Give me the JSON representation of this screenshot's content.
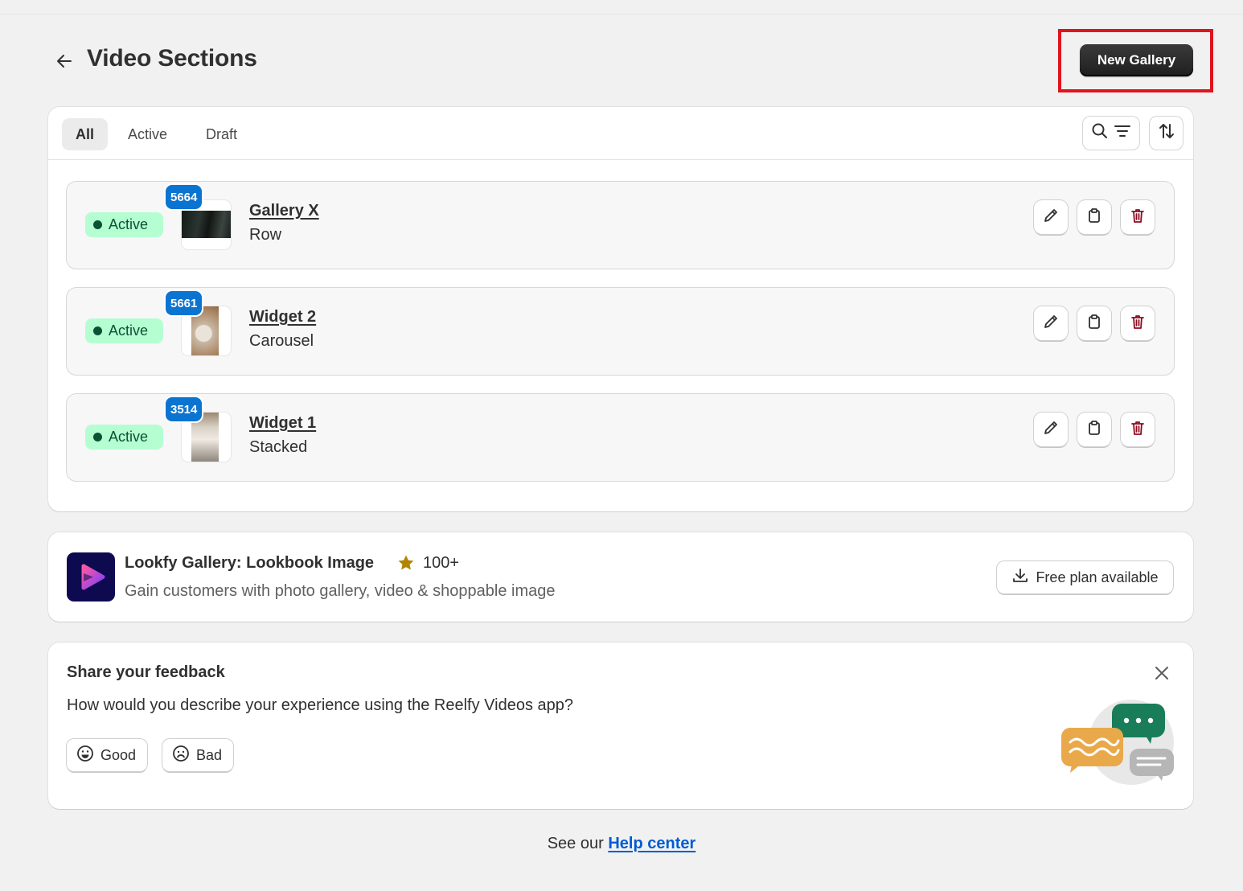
{
  "header": {
    "title": "Video Sections",
    "primary_action": "New Gallery"
  },
  "tabs": [
    {
      "label": "All",
      "selected": true
    },
    {
      "label": "Active",
      "selected": false
    },
    {
      "label": "Draft",
      "selected": false
    }
  ],
  "galleries": [
    {
      "id": "5664",
      "status": "Active",
      "name": "Gallery X",
      "layout": "Row"
    },
    {
      "id": "5661",
      "status": "Active",
      "name": "Widget 2",
      "layout": "Carousel"
    },
    {
      "id": "3514",
      "status": "Active",
      "name": "Widget 1",
      "layout": "Stacked"
    }
  ],
  "promo": {
    "app_name": "Lookfy Gallery: Lookbook Image",
    "rating_count": "100+",
    "description": "Gain customers with photo gallery, video & shoppable image",
    "cta": "Free plan available"
  },
  "feedback": {
    "title": "Share your feedback",
    "question": "How would you describe your experience using the Reelfy Videos app?",
    "good_label": "Good",
    "bad_label": "Bad"
  },
  "footer": {
    "prefix": "See our",
    "link": "Help center"
  },
  "colors": {
    "primary_button": "#303030",
    "status_bg": "#b4fed2",
    "status_text": "#0c5132",
    "id_badge": "#0b74d1",
    "delete_icon": "#8e0b21",
    "link": "#005bd3",
    "highlight_border": "#e0141e",
    "star": "#b28400"
  }
}
